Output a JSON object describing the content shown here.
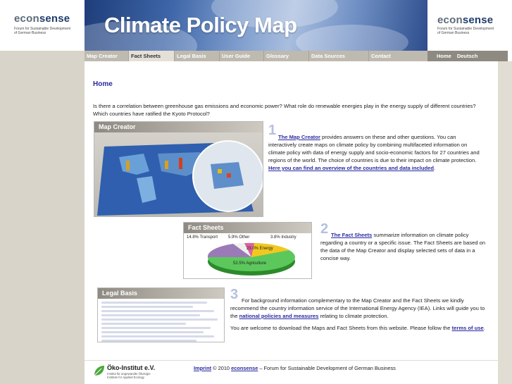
{
  "header": {
    "logo_eco": "econ",
    "logo_sense": "sense",
    "logo_sub_1": "Forum for Sustainable Development",
    "logo_sub_2": "of German Business",
    "site_title": "Climate Policy Map"
  },
  "nav": {
    "items": [
      "Map Creator",
      "Fact Sheets",
      "Legal Basis",
      "User Guide",
      "Glossary",
      "Data Sources",
      "Contact"
    ],
    "active": "Fact Sheets",
    "right": [
      "Home",
      "Deutsch"
    ]
  },
  "page": {
    "heading": "Home",
    "intro": "Is there a correlation between greenhouse gas emissions and economic power? What role do renewable energies play in the energy supply of different countries? Which countries have ratified the Kyoto Protocol?"
  },
  "blocks": [
    {
      "number": "1",
      "image_title": "Map Creator",
      "link": "The Map Creator",
      "text": " provides answers on these and other questions. You can interactively create maps on climate policy by combining multifaceted information on climate policy with data of energy supply and socio-economic factors for 27 countries and regions of the world. The choice of countries is due to their impact on climate protection. ",
      "link2": "Here you can find an overview of the countries and data included",
      "text_end": "."
    },
    {
      "number": "2",
      "image_title": "Fact Sheets",
      "link": "The Fact Sheets",
      "text": " summarize information on climate policy regarding a country or a specific issue. The Fact Sheets are based on the data of the Map Creator and display selected sets of data in a concise way.",
      "pie_labels": [
        "14.8% Transport",
        "5.9% Other",
        "3.8% Industry",
        "23.0% Energy",
        "52.5% Agriculture"
      ]
    },
    {
      "number": "3",
      "image_title": "Legal Basis",
      "text_a": "For background information complementary to the Map Creator and the Fact Sheets we kindly recommend the country information service of the International Energy Agency (IEA). Links will guide you to the ",
      "link": "national policies and measures",
      "text_b": " relating to climate protection.",
      "text_c": "You are welcome to download the Maps and Fact Sheets from this website. Please follow the ",
      "link2": "terms of use",
      "text_d": "."
    }
  ],
  "footer": {
    "oeko_name": "Öko-Institut e.V.",
    "oeko_sub_1": "Institut für angewandte Ökologie",
    "oeko_sub_2": "Institute for Applied Ecology",
    "imprint": "Imprint",
    "copyright": " © 2010 ",
    "econsense": "econsense",
    "rest": " – Forum for Sustainable Development of German Business"
  },
  "colors": {
    "link": "#2a2aa0",
    "nav_bg": "#bfbab0",
    "rail": "#d9d4c9"
  }
}
